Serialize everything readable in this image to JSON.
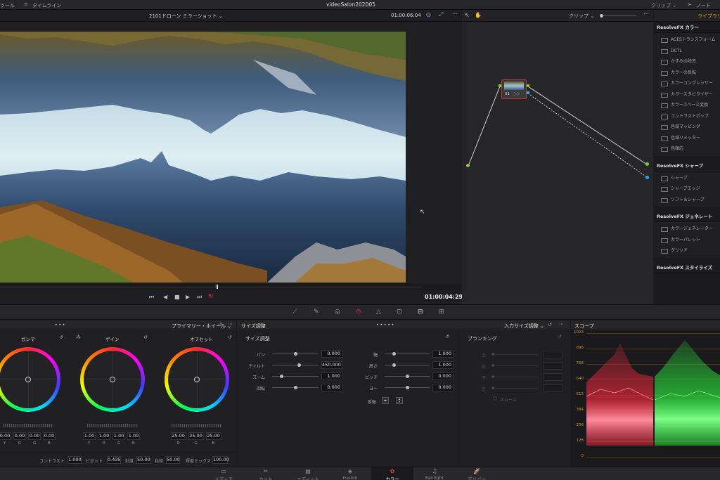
{
  "topbar": {
    "left_label": "ツール",
    "timeline_label": "タイムライン",
    "project_title": "videoSalon202005",
    "clip_label": "クリップ",
    "nodes_label": "ノード"
  },
  "viewer": {
    "clip_name": "2101ドローン ミラーショット",
    "timecode_top": "01:00:06:04",
    "timecode_current": "01:00:04:29"
  },
  "nodes": {
    "mode_label": "クリップ",
    "node_label": "01"
  },
  "library": {
    "tab_label": "ライブラリ",
    "sections": [
      {
        "title": "ResolveFX カラー",
        "items": [
          "ACESトランスフォーム",
          "DCTL",
          "かすみの除去",
          "カラーの反転",
          "カラーコンプレッサー",
          "カラースタビライザー",
          "カラースペース変換",
          "コントラストポップ",
          "色域マッピング",
          "色域リミッター",
          "色順応"
        ]
      },
      {
        "title": "ResolveFX シャープ",
        "items": [
          "シャープ",
          "シャープエッジ",
          "ソフト＆シャープ"
        ]
      },
      {
        "title": "ResolveFX ジェネレート",
        "items": [
          "カラージェネレーター",
          "カラーパレット",
          "グリッド"
        ]
      },
      {
        "title": "ResolveFX スタイライズ",
        "items": []
      }
    ]
  },
  "wheels": {
    "mode_label": "プライマリー・ホイール",
    "gamma": {
      "title": "ガンマ",
      "values": [
        "0.00",
        "0.00",
        "0.00",
        "0.00"
      ],
      "channels": [
        "Y",
        "R",
        "G",
        "B"
      ]
    },
    "gain": {
      "title": "ゲイン",
      "values": [
        "1.00",
        "1.00",
        "1.00",
        "1.00"
      ],
      "channels": [
        "Y",
        "R",
        "G",
        "B"
      ]
    },
    "offset": {
      "title": "オフセット",
      "values": [
        "25.00",
        "25.00",
        "25.00"
      ],
      "channels": [
        "R",
        "G",
        "B"
      ]
    },
    "bottom": [
      {
        "label": "コントラスト",
        "value": "1.000"
      },
      {
        "label": "ピボット",
        "value": "0.435"
      },
      {
        "label": "彩度",
        "value": "50.00"
      },
      {
        "label": "色相",
        "value": "50.00"
      },
      {
        "label": "輝度ミックス",
        "value": "100.00"
      }
    ]
  },
  "sizing": {
    "header": "サイズ調整",
    "mode_label": "入力サイズ調整",
    "section_title": "サイズ調整",
    "left_params": [
      {
        "label": "パン",
        "value": "0.000",
        "pos": 0.5
      },
      {
        "label": "ティルト",
        "value": "450.000",
        "pos": 0.58
      },
      {
        "label": "ズーム",
        "value": "1.000",
        "pos": 0.2
      },
      {
        "label": "回転",
        "value": "0.000",
        "pos": 0.5
      }
    ],
    "right_params": [
      {
        "label": "幅",
        "value": "1.000",
        "pos": 0.2
      },
      {
        "label": "高さ",
        "value": "1.000",
        "pos": 0.2
      },
      {
        "label": "ピッチ",
        "value": "0.000",
        "pos": 0.5
      },
      {
        "label": "ヨー",
        "value": "0.000",
        "pos": 0.5
      }
    ],
    "flip_label": "反転",
    "blanking": {
      "title": "ブランキング",
      "params": [
        "上",
        "右",
        "下",
        "左"
      ],
      "smooth_label": "スムース"
    }
  },
  "scope": {
    "title": "スコープ",
    "ticks": [
      "1023",
      "896",
      "768",
      "640",
      "512",
      "384",
      "256",
      "128",
      "0"
    ]
  },
  "pages": [
    {
      "label": "メディア",
      "icon": "media-icon"
    },
    {
      "label": "カット",
      "icon": "cut-icon"
    },
    {
      "label": "エディット",
      "icon": "edit-icon"
    },
    {
      "label": "Fusion",
      "icon": "fusion-icon"
    },
    {
      "label": "カラー",
      "icon": "color-icon",
      "active": true
    },
    {
      "label": "Fairlight",
      "icon": "fairlight-icon"
    },
    {
      "label": "デリバー",
      "icon": "deliver-icon"
    }
  ],
  "colors": {
    "accent": "#e2423c",
    "scope_red": "#e8283c",
    "scope_green": "#2be63c",
    "node_link": "#c8c8c8"
  }
}
